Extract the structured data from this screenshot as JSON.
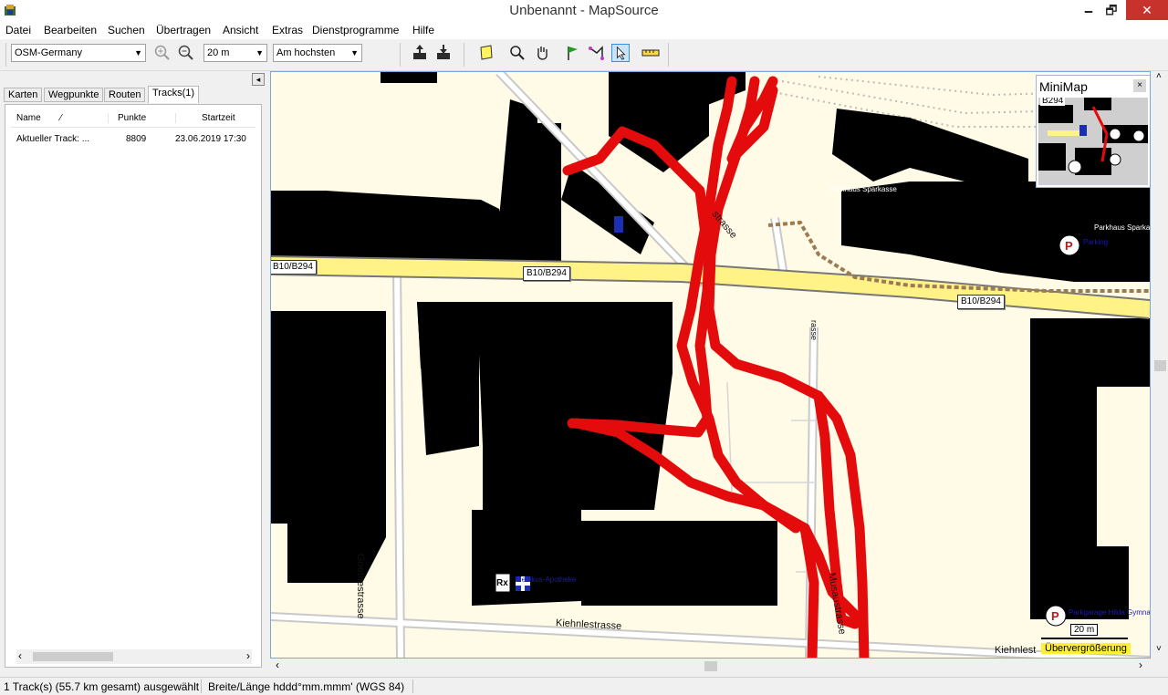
{
  "window": {
    "title": "Unbenannt - MapSource",
    "minimize": "🗕",
    "restore": "🗗",
    "close": "✕"
  },
  "menu": [
    "Datei",
    "Bearbeiten",
    "Suchen",
    "Übertragen",
    "Ansicht",
    "Extras",
    "Dienstprogramme",
    "Hilfe"
  ],
  "toolbar": {
    "map_product": "OSM-Germany",
    "zoom_scale": "20 m",
    "detail_level": "Am hochsten"
  },
  "panel": {
    "collapse_glyph": "◂",
    "tabs": [
      "Karten",
      "Wegpunkte",
      "Routen",
      "Tracks(1)"
    ],
    "columns": {
      "name": "Name",
      "sort_glyph": "⁄",
      "points": "Punkte",
      "start": "Startzeit"
    },
    "rows": [
      {
        "name": "Aktueller Track: ...",
        "points": "8809",
        "start": "23.06.2019 17:30"
      }
    ],
    "scroll_left": "‹",
    "scroll_right": "›"
  },
  "map": {
    "road_labels": {
      "b10_left": "B10/B294",
      "b10_mid": "B10/B294",
      "b10_right": "B10/B294",
      "goethe": "Goethestrasse",
      "kiehnle": "Kiehnlestrasse",
      "kiehnle2": "Kiehnlest",
      "musau": "Musaustrasse",
      "strasse_top": "strasse",
      "strasse_mid": "rasse"
    },
    "poi": {
      "parkhaus1": "Parkhaus Sparkasse",
      "parkhaus2": "Parkhaus Sparkasse",
      "parking": "Parking",
      "apotheke": "Medikus-Apotheke",
      "parkgarage": "Parkgarage Hilda Gymnasium",
      "rx": "Rx",
      "p1": "P",
      "p2": "P"
    },
    "scale": "20 m",
    "overzoom": "Übervergrößerung",
    "scroll_left": "‹",
    "scroll_right": "›",
    "scroll_up": "˄",
    "scroll_down": "˅"
  },
  "minimap": {
    "title": "MiniMap",
    "close": "×",
    "label": "B294"
  },
  "status": {
    "selection": "1 Track(s) (55.7 km gesamt) ausgewählt",
    "coords": "Breite/Länge hddd°mm.mmm' (WGS 84)"
  },
  "colors": {
    "track": "#e30b0b",
    "building": "#000000",
    "land": "#fffbe7",
    "main_road": "#fff387",
    "accent": "#3d8ee0"
  }
}
